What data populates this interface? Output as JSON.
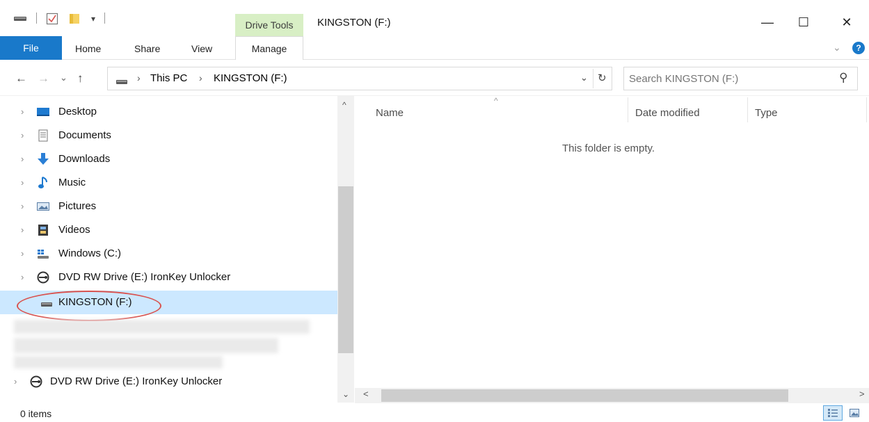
{
  "window": {
    "title": "KINGSTON (F:)",
    "minimize_glyph": "—",
    "maximize_glyph": "☐",
    "close_glyph": "✕"
  },
  "ribbon": {
    "context_group": "Drive Tools",
    "tabs": [
      {
        "label": "File"
      },
      {
        "label": "Home"
      },
      {
        "label": "Share"
      },
      {
        "label": "View"
      },
      {
        "label": "Manage"
      }
    ],
    "expand_glyph": "⌄",
    "help_glyph": "?"
  },
  "address": {
    "back_glyph": "←",
    "forward_glyph": "→",
    "recent_glyph": "⌄",
    "up_glyph": "↑",
    "crumbs": [
      "This PC",
      "KINGSTON (F:)"
    ],
    "crumb_sep": "›",
    "dropdown_glyph": "⌄",
    "refresh_glyph": "↻"
  },
  "search": {
    "placeholder": "Search KINGSTON (F:)",
    "icon_glyph": "⚲"
  },
  "nav": {
    "items": [
      {
        "label": "Desktop",
        "icon": "desktop-icon"
      },
      {
        "label": "Documents",
        "icon": "documents-icon"
      },
      {
        "label": "Downloads",
        "icon": "downloads-icon"
      },
      {
        "label": "Music",
        "icon": "music-icon"
      },
      {
        "label": "Pictures",
        "icon": "pictures-icon"
      },
      {
        "label": "Videos",
        "icon": "videos-icon"
      },
      {
        "label": "Windows (C:)",
        "icon": "windows-drive-icon"
      },
      {
        "label": "DVD RW Drive (E:) IronKey Unlocker",
        "icon": "dvd-drive-icon"
      },
      {
        "label": "KINGSTON (F:)",
        "icon": "usb-drive-icon"
      },
      {
        "label": "DVD RW Drive (E:) IronKey Unlocker",
        "icon": "dvd-drive-icon"
      }
    ],
    "chevron_glyph": "›",
    "scroll_up_glyph": "^",
    "scroll_down_glyph": "⌄"
  },
  "content": {
    "columns": [
      "Name",
      "Date modified",
      "Type"
    ],
    "sort_glyph": "^",
    "empty_message": "This folder is empty.",
    "scroll_left_glyph": "<",
    "scroll_right_glyph": ">"
  },
  "status": {
    "items_text": "0 items"
  },
  "colors": {
    "accent": "#1979ca",
    "selection": "#cce8ff",
    "drive_tools_tab": "#d8efc5",
    "highlight_ring": "#d9534f"
  }
}
